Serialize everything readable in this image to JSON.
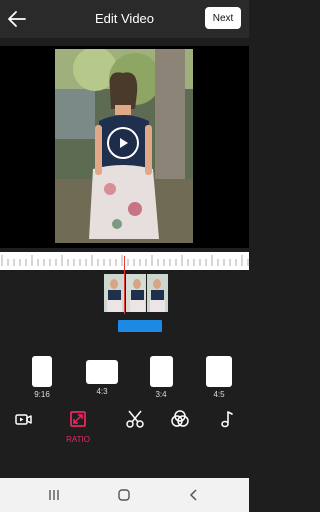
{
  "header": {
    "title": "Edit Video",
    "next_label": "Next",
    "back_icon": "arrow-left-icon"
  },
  "preview": {
    "play_icon": "play-circle-icon"
  },
  "timeline": {
    "clip_thumbnails": 3,
    "playhead_color": "#e53935",
    "audio_track_color": "#1e88e5"
  },
  "ratios": [
    {
      "label": "9:16"
    },
    {
      "label": "4:3"
    },
    {
      "label": "3:4"
    },
    {
      "label": "4:5"
    }
  ],
  "tools": [
    {
      "icon": "video-camera-icon",
      "label": ""
    },
    {
      "icon": "ratio-icon",
      "label": "RATIO",
      "active": true
    },
    {
      "icon": "scissors-icon",
      "label": ""
    },
    {
      "icon": "filter-icon",
      "label": ""
    },
    {
      "icon": "music-note-icon",
      "label": ""
    }
  ],
  "colors": {
    "accent": "#e8285e",
    "background": "#1e1e1e",
    "header": "#2a2a2a"
  },
  "navbar": {
    "recent_icon": "recent-apps-icon",
    "home_icon": "home-icon",
    "back_icon": "nav-back-icon"
  }
}
